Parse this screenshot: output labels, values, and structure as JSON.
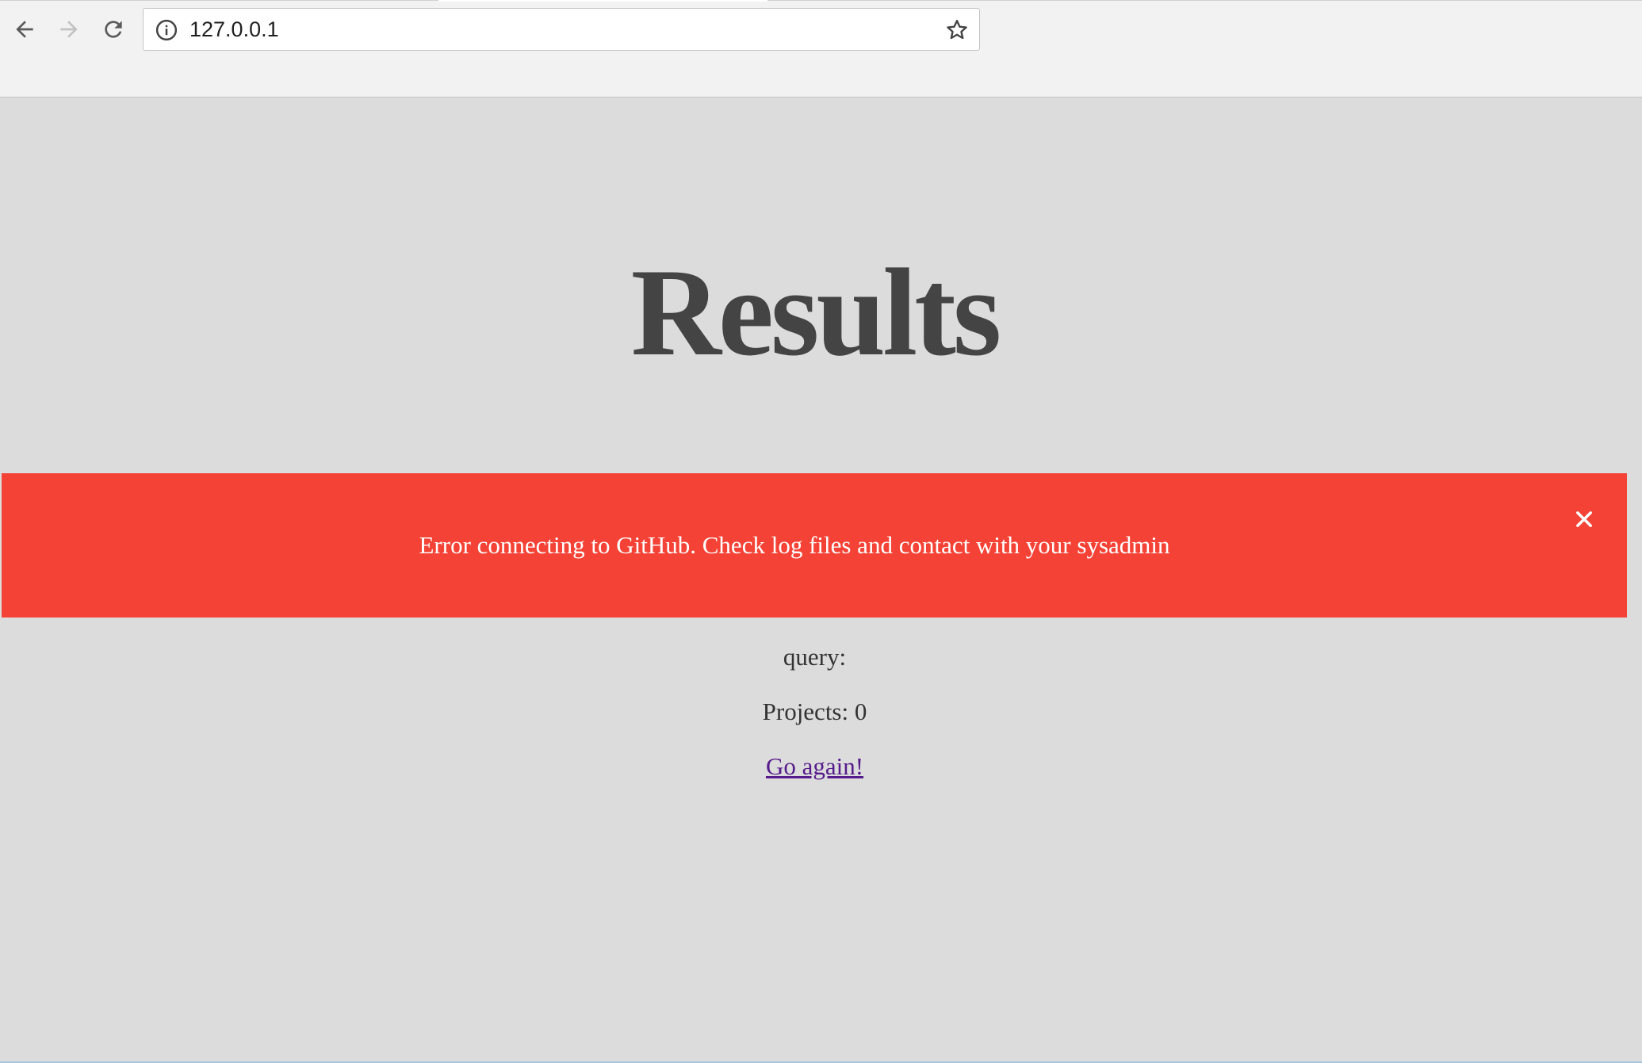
{
  "browser": {
    "url": "127.0.0.1",
    "icons": {
      "back": "arrow-left-icon",
      "forward": "arrow-right-icon",
      "reload": "reload-icon",
      "site_info": "info-icon",
      "bookmark": "star-icon"
    }
  },
  "page": {
    "title": "Results",
    "alert": {
      "message": "Error connecting to GitHub. Check log files and contact with your sysadmin",
      "close_icon": "close-icon",
      "color": "#f44336"
    },
    "query_label": "query:",
    "projects_label": "Projects: 0",
    "go_again_link": "Go again!"
  },
  "colors": {
    "background": "#dcdcdc",
    "title": "#444444",
    "link_visited": "#551a8b"
  }
}
